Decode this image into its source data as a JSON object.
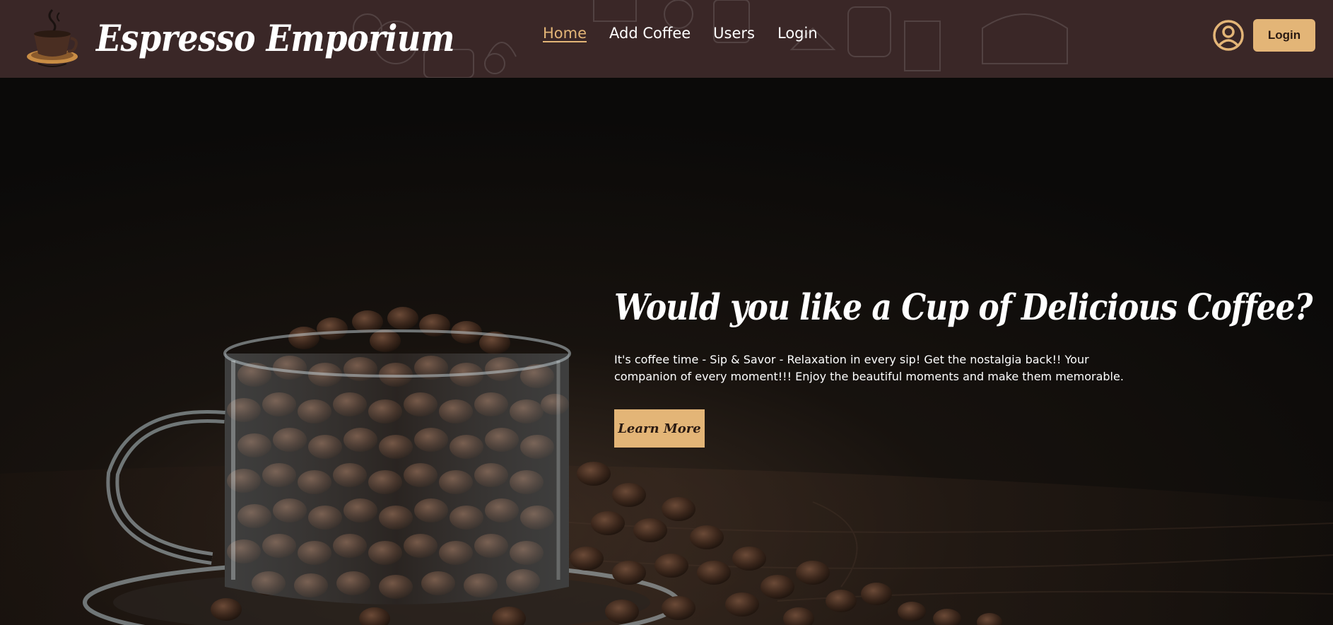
{
  "header": {
    "brand_title": "Espresso Emporium",
    "logo_icon": "coffee-cup-logo",
    "nav": [
      {
        "label": "Home",
        "active": true
      },
      {
        "label": "Add Coffee",
        "active": false
      },
      {
        "label": "Users",
        "active": false
      },
      {
        "label": "Login",
        "active": false
      }
    ],
    "user_icon": "user-circle-icon",
    "login_button": "Login"
  },
  "hero": {
    "heading": "Would you like a Cup of Delicious Coffee?",
    "text": "It's coffee time - Sip & Savor - Relaxation in every sip! Get the nostalgia back!! Your companion of every moment!!! Enjoy the beautiful moments and make them memorable.",
    "button": "Learn More"
  },
  "colors": {
    "header_bg": "#3a2727",
    "accent": "#e3b577",
    "hero_bg": "#0f0d0b"
  }
}
